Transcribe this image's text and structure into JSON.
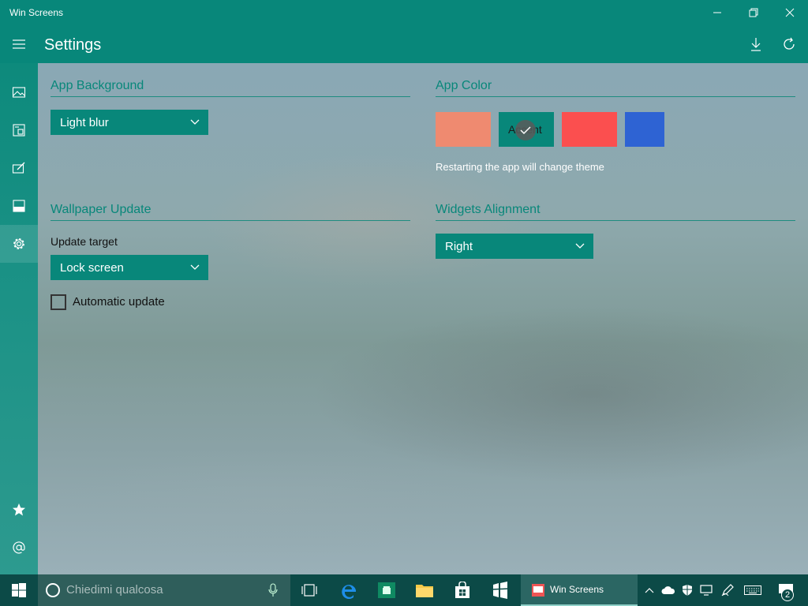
{
  "window": {
    "title": "Win Screens"
  },
  "header": {
    "title": "Settings"
  },
  "app_background": {
    "title": "App Background",
    "dropdown_value": "Light blur"
  },
  "wallpaper_update": {
    "title": "Wallpaper Update",
    "target_label": "Update target",
    "target_value": "Lock screen",
    "auto_update_label": "Automatic update",
    "auto_update_checked": false
  },
  "app_color": {
    "title": "App Color",
    "swatches": [
      {
        "color": "#ef8a70",
        "label": ""
      },
      {
        "color": "#08877a",
        "label": "Accent",
        "selected": true
      },
      {
        "color": "#fb4f4f",
        "label": ""
      },
      {
        "color": "#2e63d3",
        "label": ""
      }
    ],
    "note": "Restarting the app will change theme"
  },
  "widgets_alignment": {
    "title": "Widgets Alignment",
    "dropdown_value": "Right"
  },
  "taskbar": {
    "search_placeholder": "Chiedimi qualcosa",
    "running_app": "Win Screens",
    "notification_count": "2"
  },
  "colors": {
    "accent": "#08877a",
    "taskbar": "#0c4a47"
  }
}
